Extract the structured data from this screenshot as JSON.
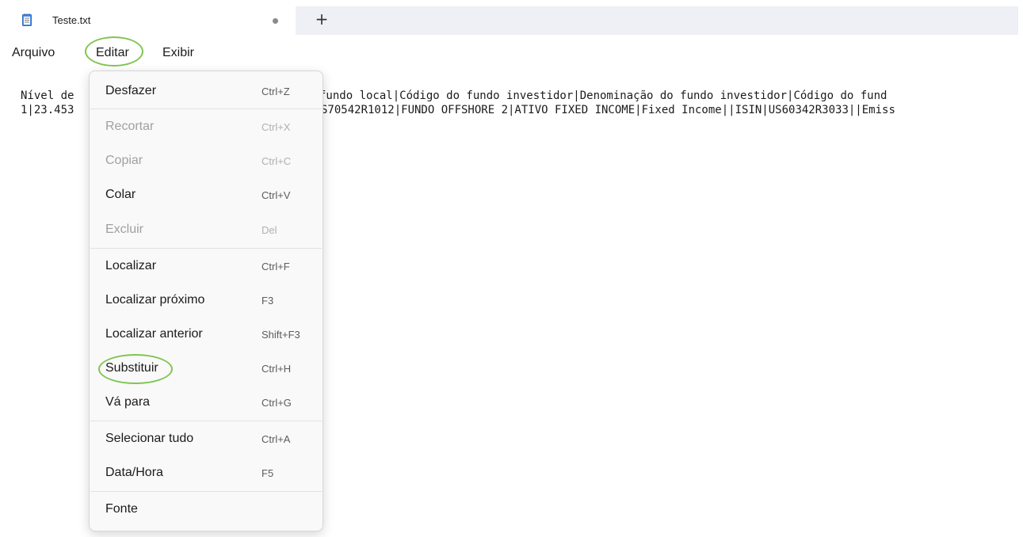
{
  "tab": {
    "title": "Teste.txt",
    "icon": "notepad-icon",
    "unsaved_indicator": "●",
    "new_tab_label": "+"
  },
  "menubar": {
    "arquivo": "Arquivo",
    "editar": "Editar",
    "exibir": "Exibir"
  },
  "editor": {
    "line1_left": "Nível de",
    "line1_right": "fundo local|Código do fundo investidor|Denominação do fundo investidor|Código do fund",
    "line2_left": "1|23.453",
    "line2_right": "S70542R1012|FUNDO OFFSHORE 2|ATIVO FIXED INCOME|Fixed Income||ISIN|US60342R3033||Emiss"
  },
  "edit_menu": {
    "items": [
      {
        "label": "Desfazer",
        "shortcut": "Ctrl+Z",
        "enabled": true
      },
      {
        "label": "Recortar",
        "shortcut": "Ctrl+X",
        "enabled": false
      },
      {
        "label": "Copiar",
        "shortcut": "Ctrl+C",
        "enabled": false
      },
      {
        "label": "Colar",
        "shortcut": "Ctrl+V",
        "enabled": true
      },
      {
        "label": "Excluir",
        "shortcut": "Del",
        "enabled": false
      },
      {
        "label": "Localizar",
        "shortcut": "Ctrl+F",
        "enabled": true
      },
      {
        "label": "Localizar próximo",
        "shortcut": "F3",
        "enabled": true
      },
      {
        "label": "Localizar anterior",
        "shortcut": "Shift+F3",
        "enabled": true
      },
      {
        "label": "Substituir",
        "shortcut": "Ctrl+H",
        "enabled": true
      },
      {
        "label": "Vá para",
        "shortcut": "Ctrl+G",
        "enabled": true
      },
      {
        "label": "Selecionar tudo",
        "shortcut": "Ctrl+A",
        "enabled": true
      },
      {
        "label": "Data/Hora",
        "shortcut": "F5",
        "enabled": true
      },
      {
        "label": "Fonte",
        "shortcut": "",
        "enabled": true
      }
    ]
  },
  "colors": {
    "highlight_ring": "#7fc551",
    "tabbar_bg": "#eef0f5"
  }
}
